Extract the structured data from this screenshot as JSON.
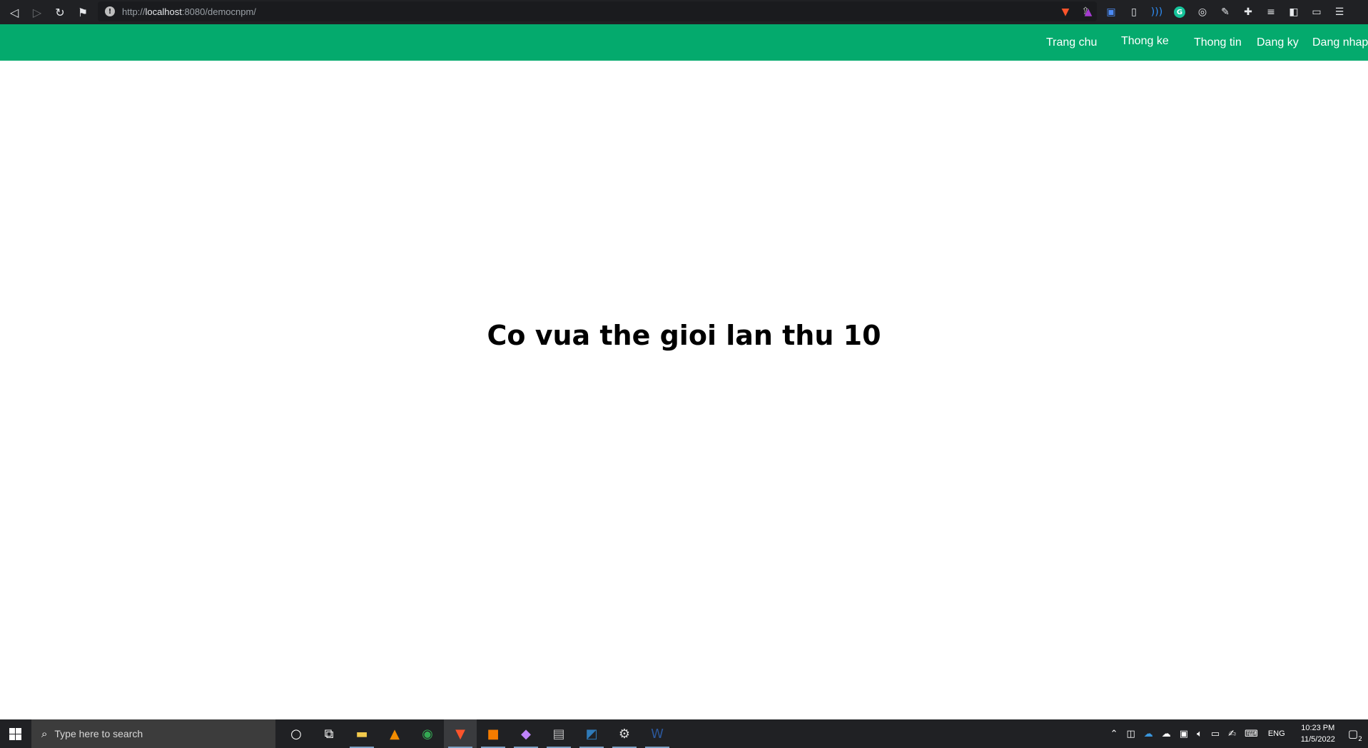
{
  "browser": {
    "url_scheme": "http://",
    "url_host": "localhost",
    "url_path": ":8080/democnpm/"
  },
  "site_nav": {
    "links": [
      {
        "label": "Trang chu"
      },
      {
        "label": "Thong ke"
      },
      {
        "label": "Thong tin"
      },
      {
        "label": "Dang ky"
      },
      {
        "label": "Dang nhap"
      }
    ],
    "color": "#04aa6d"
  },
  "main": {
    "title": "Co vua the gioi lan thu 10"
  },
  "taskbar": {
    "search_placeholder": "Type here to search",
    "language": "ENG",
    "time": "10:23 PM",
    "date": "11/5/2022",
    "notification_count": "2"
  }
}
